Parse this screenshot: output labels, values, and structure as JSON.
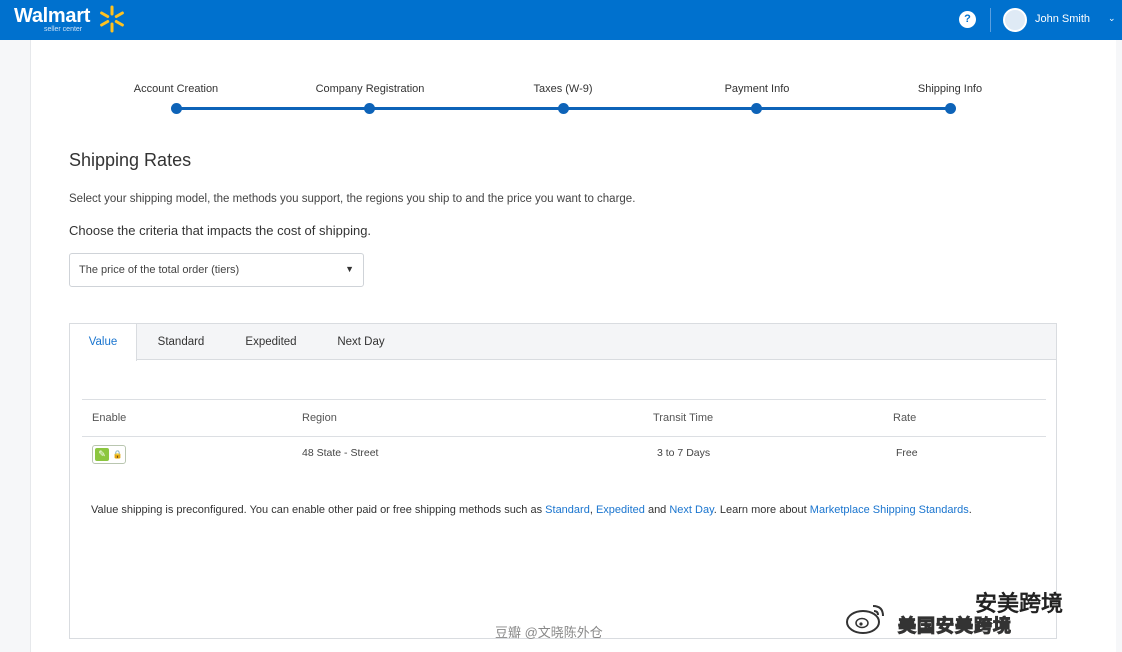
{
  "header": {
    "logo_text": "Walmart",
    "logo_subtext": "seller center",
    "help_label": "?",
    "user_name": "John Smith",
    "brand_color": "#0071ce"
  },
  "steps": [
    {
      "label": "Account Creation"
    },
    {
      "label": "Company Registration"
    },
    {
      "label": "Taxes (W-9)"
    },
    {
      "label": "Payment Info"
    },
    {
      "label": "Shipping Info"
    }
  ],
  "section": {
    "title": "Shipping Rates",
    "description": "Select your shipping model, the methods you support, the regions you ship to and the price you want to charge.",
    "criteria_prompt": "Choose the criteria that impacts the cost of shipping.",
    "criteria_selected": "The price of the total order (tiers)"
  },
  "tabs": [
    {
      "label": "Value",
      "active": true
    },
    {
      "label": "Standard",
      "active": false
    },
    {
      "label": "Expedited",
      "active": false
    },
    {
      "label": "Next Day",
      "active": false
    }
  ],
  "table": {
    "columns": [
      "Enable",
      "Region",
      "Transit Time",
      "Rate"
    ],
    "rows": [
      {
        "enabled": true,
        "region": "48 State - Street",
        "transit_time": "3 to 7 Days",
        "rate": "Free"
      }
    ]
  },
  "note": {
    "prefix": "Value shipping is preconfigured. You can enable other paid or free shipping methods such as ",
    "link_standard": "Standard",
    "sep1": ", ",
    "link_expedited": "Expedited",
    "mid": " and ",
    "link_nextday": "Next Day",
    "suffix": ". Learn more about ",
    "link_standards": "Marketplace Shipping Standards",
    "end": "."
  },
  "watermark": {
    "bottom_text": "豆瓣 @文晓陈外仓",
    "name": "安美跨境",
    "handle": "美国安美跨境"
  },
  "colors": {
    "step_blue": "#0d63b8",
    "link_blue": "#1a75cf",
    "toggle_green": "#8cc63f"
  }
}
